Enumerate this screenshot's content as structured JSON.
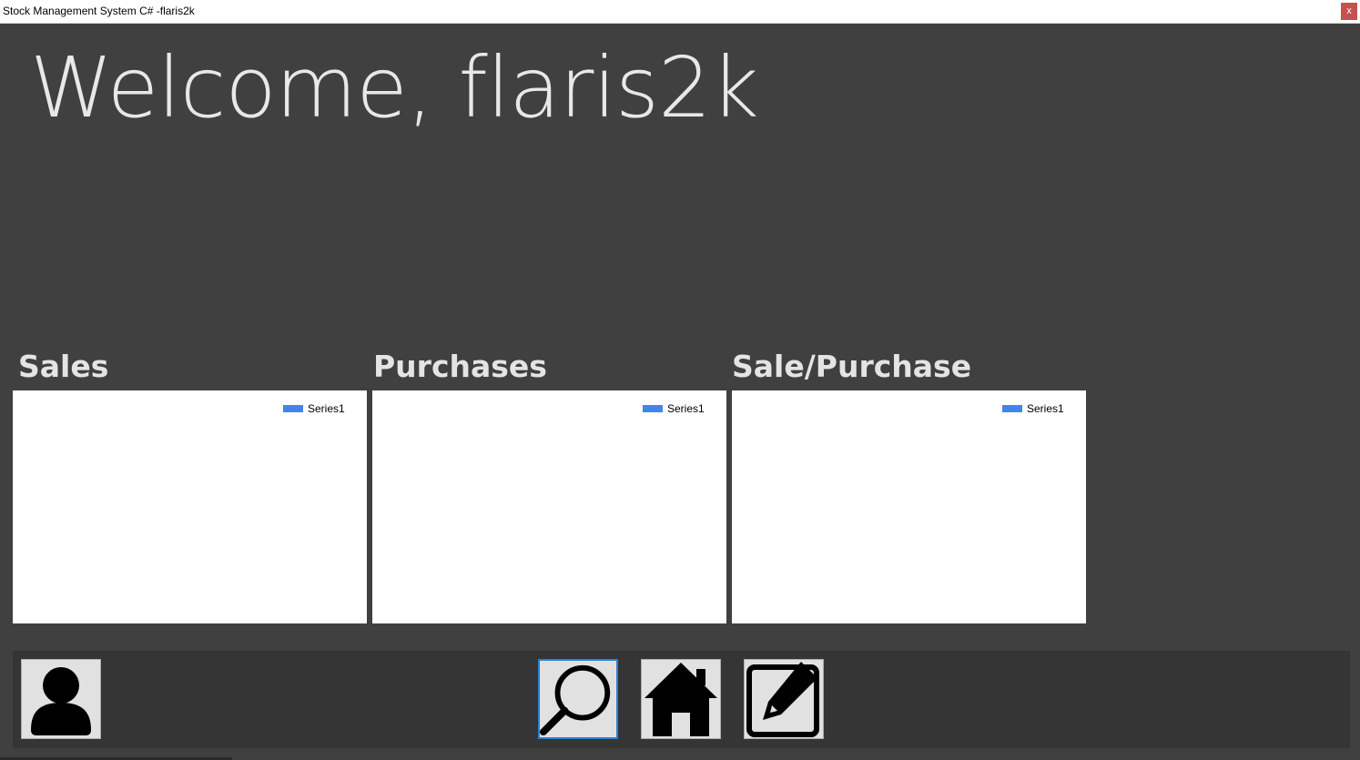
{
  "window": {
    "title": "Stock Management System C# -flaris2k",
    "close_label": "x"
  },
  "welcome_text": "Welcome, flaris2k",
  "charts": [
    {
      "title": "Sales",
      "legend": "Series1"
    },
    {
      "title": "Purchases",
      "legend": "Series1"
    },
    {
      "title": "Sale/Purchase",
      "legend": "Series1"
    }
  ],
  "colors": {
    "background": "#404040",
    "series": "#4285e8",
    "active_border": "#2b7fd6",
    "close_button": "#c75050"
  },
  "toolbar": {
    "buttons": [
      {
        "icon": "user-icon"
      },
      {
        "icon": "search-icon",
        "active": true
      },
      {
        "icon": "home-icon"
      },
      {
        "icon": "edit-icon"
      }
    ]
  }
}
